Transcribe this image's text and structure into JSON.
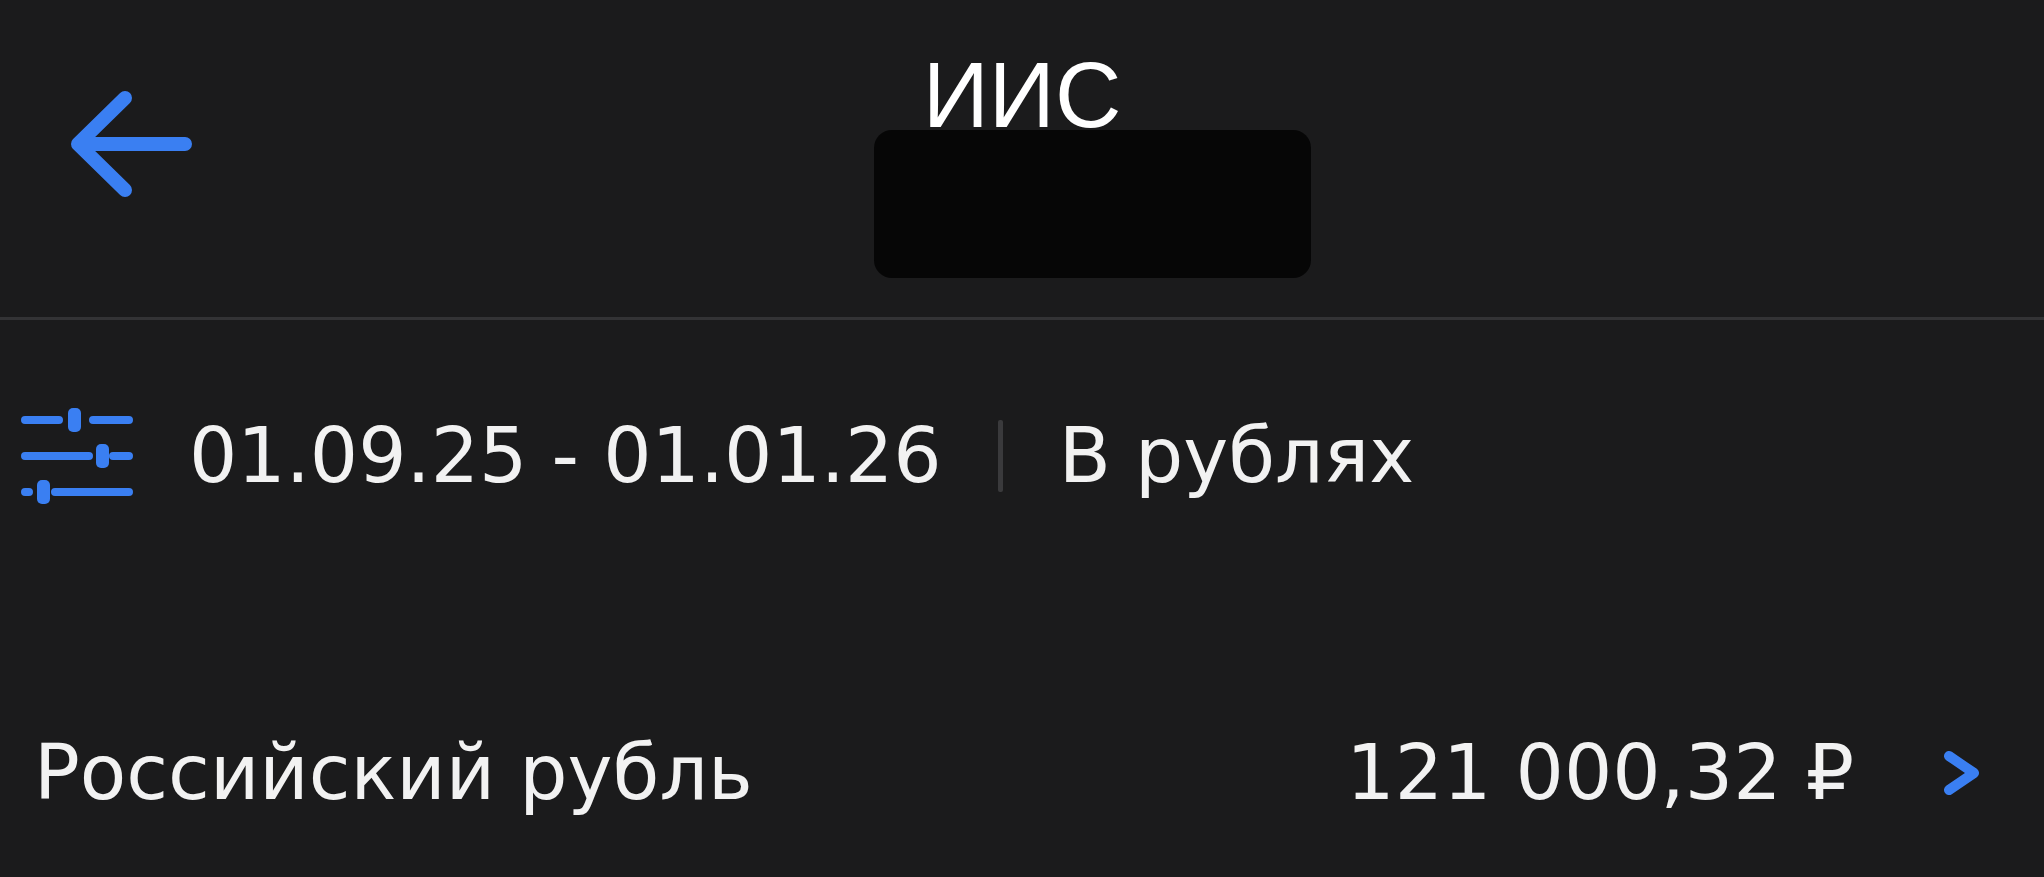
{
  "header": {
    "title": "ИИС"
  },
  "filter_bar": {
    "period": "01.09.25 - 01.01.26",
    "currency_mode": "В рублях"
  },
  "accounts": [
    {
      "name": "Российский рубль",
      "amount": "121 000,32 ₽"
    }
  ]
}
